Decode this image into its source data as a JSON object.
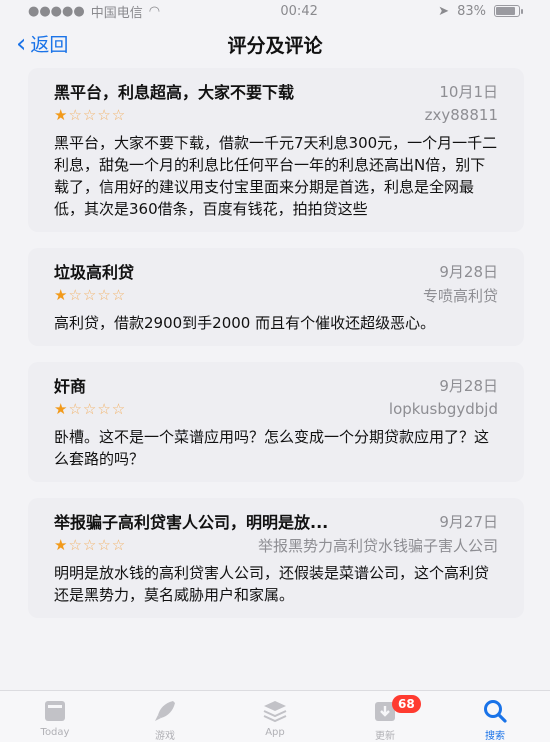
{
  "status_bar": {
    "carrier": "中国电信",
    "time": "00:42",
    "battery": "83%"
  },
  "nav": {
    "back_label": "返回",
    "title": "评分及评论"
  },
  "reviews": [
    {
      "title": "黑平台，利息超高，大家不要下载",
      "date": "10月1日",
      "author": "zxy88811",
      "rating": 1,
      "body": "黑平台，大家不要下载，借款一千元7天利息300元，一个月一千二利息，甜兔一个月的利息比任何平台一年的利息还高出N倍，别下载了，信用好的建议用支付宝里面来分期是首选，利息是全网最低，其次是360借条，百度有钱花，拍拍贷这些"
    },
    {
      "title": "垃圾高利贷",
      "date": "9月28日",
      "author": "专喷高利贷",
      "rating": 1,
      "body": "高利贷，借款2900到手2000 而且有个催收还超级恶心。"
    },
    {
      "title": "奸商",
      "date": "9月28日",
      "author": "lopkusbgydbjd",
      "rating": 1,
      "body": "卧槽。这不是一个菜谱应用吗？怎么变成一个分期贷款应用了？这么套路的吗？"
    },
    {
      "title": "举报骗子高利贷害人公司，明明是放...",
      "date": "9月27日",
      "author": "举报黑势力高利贷水钱骗子害人公司",
      "rating": 1,
      "body": "明明是放水钱的高利贷害人公司，还假装是菜谱公司，这个高利贷还是黑势力，莫名威胁用户和家属。"
    }
  ],
  "stars": {
    "on": "★",
    "off": "☆☆☆☆"
  },
  "tab_bar": {
    "updates_badge": "68",
    "tabs": [
      {
        "label": "Today",
        "icon": "today-icon"
      },
      {
        "label": "游戏",
        "icon": "rocket-icon"
      },
      {
        "label": "App",
        "icon": "layers-icon"
      },
      {
        "label": "更新",
        "icon": "download-icon"
      },
      {
        "label": "搜索",
        "icon": "search-icon"
      }
    ]
  },
  "colors": {
    "accent": "#1a73e8",
    "star": "#f29a1a",
    "badge": "#ff3b30"
  }
}
